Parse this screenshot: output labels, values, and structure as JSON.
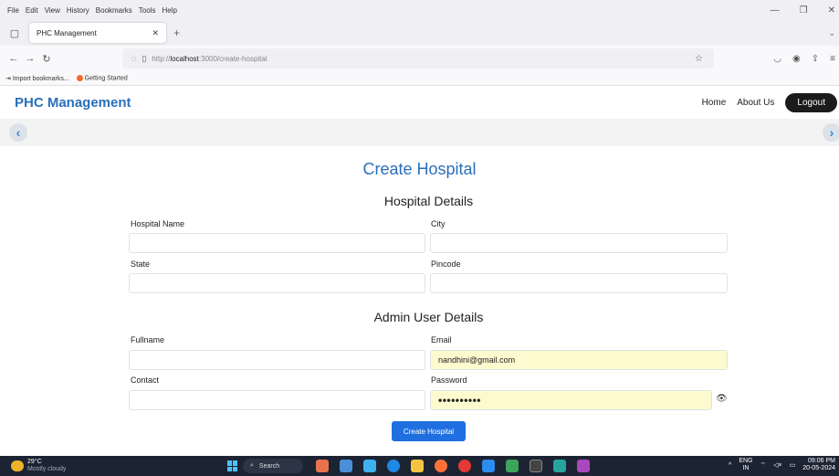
{
  "browser": {
    "menus": [
      "File",
      "Edit",
      "View",
      "History",
      "Bookmarks",
      "Tools",
      "Help"
    ],
    "tab_title": "PHC Management",
    "url_prefix": "http://",
    "url_host": "localhost",
    "url_path": ":3000/create-hospital",
    "bookmarks": [
      "Import bookmarks...",
      "Getting Started"
    ]
  },
  "app": {
    "brand": "PHC Management",
    "nav": {
      "home": "Home",
      "about": "About Us",
      "logout": "Logout"
    }
  },
  "form": {
    "title": "Create Hospital",
    "hospital_section": "Hospital Details",
    "admin_section": "Admin User Details",
    "labels": {
      "hospital_name": "Hospital Name",
      "city": "City",
      "state": "State",
      "pincode": "Pincode",
      "fullname": "Fullname",
      "email": "Email",
      "contact": "Contact",
      "password": "Password"
    },
    "values": {
      "email": "nandhini@gmail.com",
      "password": "••••••••••"
    },
    "submit": "Create Hospital"
  },
  "taskbar": {
    "temp": "29°C",
    "weather": "Mostly cloudy",
    "search": "Search",
    "lang": "ENG",
    "region": "IN",
    "time": "09:06 PM",
    "date": "20-05-2024"
  },
  "colors": {
    "brand": "#2a6fbb",
    "primary_button": "#1f6fe0",
    "autofill": "#fefacf",
    "taskbar": "#1c2433"
  }
}
